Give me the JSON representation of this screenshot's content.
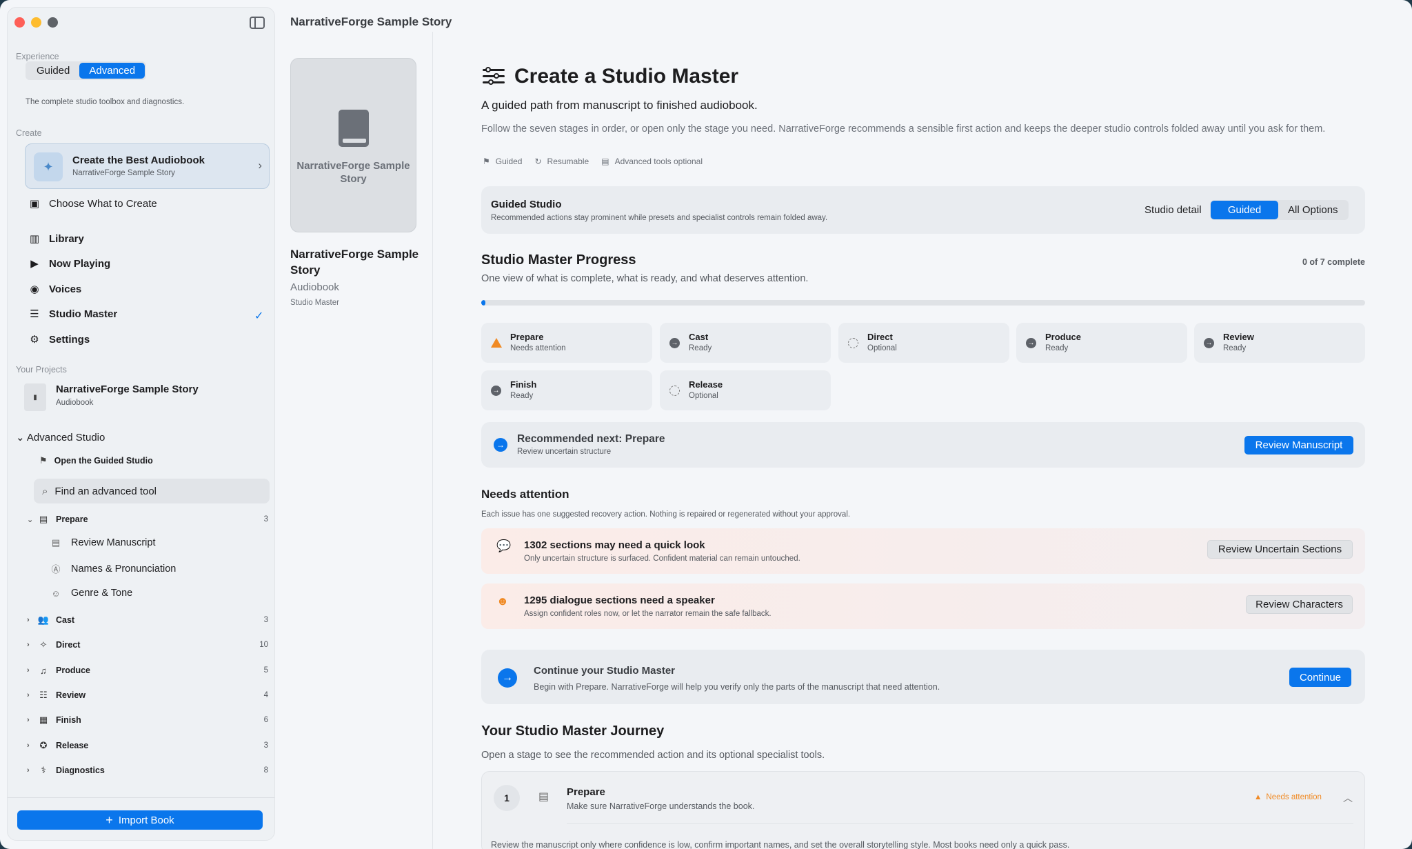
{
  "window": {
    "title": "NarrativeForge Sample Story"
  },
  "sidebar": {
    "experience_label": "Experience",
    "experience_options": [
      "Guided",
      "Advanced"
    ],
    "experience_selected": "Advanced",
    "experience_note": "The complete studio toolbox and diagnostics.",
    "create_label": "Create",
    "create_card": {
      "title": "Create the Best Audiobook",
      "subtitle": "NarrativeForge Sample Story"
    },
    "choose_label": "Choose What to Create",
    "nav": [
      {
        "label": "Library",
        "icon": "library-icon"
      },
      {
        "label": "Now Playing",
        "icon": "play-circle-icon"
      },
      {
        "label": "Voices",
        "icon": "waveform-icon"
      },
      {
        "label": "Studio Master",
        "icon": "sliders-icon",
        "selected": true
      },
      {
        "label": "Settings",
        "icon": "gear-icon"
      }
    ],
    "projects_label": "Your Projects",
    "project": {
      "title": "NarrativeForge Sample Story",
      "type": "Audiobook"
    },
    "advanced_label": "Advanced Studio",
    "open_guided": "Open the Guided Studio",
    "search_placeholder": "Find an advanced tool",
    "tree": [
      {
        "label": "Prepare",
        "count": "3",
        "expanded": true,
        "icon": "document-icon"
      },
      {
        "label": "Cast",
        "count": "3",
        "icon": "people-icon"
      },
      {
        "label": "Direct",
        "count": "10",
        "icon": "wand-icon"
      },
      {
        "label": "Produce",
        "count": "5",
        "icon": "waveform-icon"
      },
      {
        "label": "Review",
        "count": "4",
        "icon": "list-icon"
      },
      {
        "label": "Finish",
        "count": "6",
        "icon": "waveform-box-icon"
      },
      {
        "label": "Release",
        "count": "3",
        "icon": "seal-check-icon"
      },
      {
        "label": "Diagnostics",
        "count": "8",
        "icon": "stethoscope-icon"
      }
    ],
    "prepare_children": [
      "Review Manuscript",
      "Names & Pronunciation",
      "Genre & Tone"
    ],
    "import_label": "Import Book"
  },
  "book": {
    "cover_title": "NarrativeForge Sample Story",
    "title": "NarrativeForge Sample Story",
    "type": "Audiobook",
    "mode": "Studio Master"
  },
  "main": {
    "title": "Create a Studio Master",
    "subtitle": "A guided path from manuscript to finished audiobook.",
    "description": "Follow the seven stages in order, or open only the stage you need. NarrativeForge recommends a sensible first action and keeps the deeper studio controls folded away until you ask for them.",
    "tags": [
      "Guided",
      "Resumable",
      "Advanced tools optional"
    ],
    "guided_studio": {
      "title": "Guided Studio",
      "note": "Recommended actions stay prominent while presets and specialist controls remain folded away.",
      "detail_label": "Studio detail",
      "options": [
        "Guided",
        "All Options"
      ],
      "selected": "Guided"
    },
    "progress": {
      "title": "Studio Master Progress",
      "subtitle": "One view of what is complete, what is ready, and what deserves attention.",
      "count": "0 of 7 complete",
      "fraction": 0.005
    },
    "stages": [
      {
        "name": "Prepare",
        "status": "Needs attention",
        "kind": "warn"
      },
      {
        "name": "Cast",
        "status": "Ready",
        "kind": "arrow"
      },
      {
        "name": "Direct",
        "status": "Optional",
        "kind": "dash"
      },
      {
        "name": "Produce",
        "status": "Ready",
        "kind": "arrow"
      },
      {
        "name": "Review",
        "status": "Ready",
        "kind": "arrow"
      },
      {
        "name": "Finish",
        "status": "Ready",
        "kind": "arrow"
      },
      {
        "name": "Release",
        "status": "Optional",
        "kind": "dash"
      }
    ],
    "recommended": {
      "title": "Recommended next: Prepare",
      "subtitle": "Review uncertain structure",
      "button": "Review Manuscript"
    },
    "needs_attention": {
      "title": "Needs attention",
      "subtitle": "Each issue has one suggested recovery action. Nothing is repaired or regenerated without your approval.",
      "issues": [
        {
          "title": "1302 sections may need a quick look",
          "subtitle": "Only uncertain structure is surfaced. Confident material can remain untouched.",
          "button": "Review Uncertain Sections"
        },
        {
          "title": "1295 dialogue sections need a speaker",
          "subtitle": "Assign confident roles now, or let the narrator remain the safe fallback.",
          "button": "Review Characters"
        }
      ]
    },
    "continue": {
      "title": "Continue your Studio Master",
      "subtitle": "Begin with Prepare. NarrativeForge will help you verify only the parts of the manuscript that need attention.",
      "button": "Continue"
    },
    "journey": {
      "title": "Your Studio Master Journey",
      "subtitle": "Open a stage to see the recommended action and its optional specialist tools.",
      "step": {
        "number": "1",
        "title": "Prepare",
        "subtitle": "Make sure NarrativeForge understands the book.",
        "flag": "Needs attention",
        "body": "Review the manuscript only where confidence is low, confirm important names, and set the overall storytelling style. Most books need only a quick pass."
      }
    }
  },
  "colors": {
    "accent": "#0a76ec",
    "warning": "#f08a24"
  }
}
